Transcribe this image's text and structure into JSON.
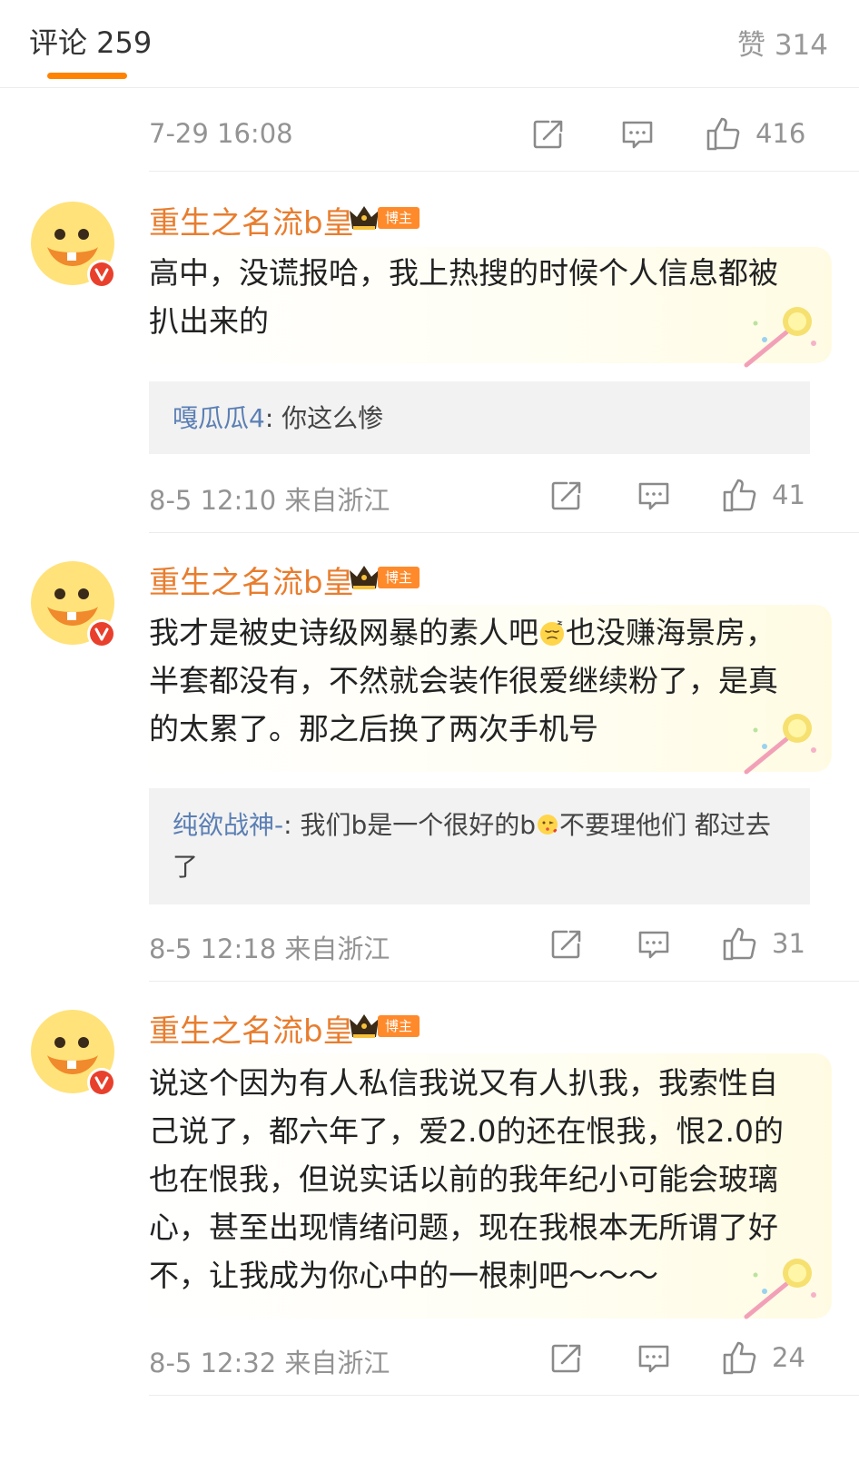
{
  "header": {
    "comments_tab": "评论 259",
    "likes_tab": "赞 314"
  },
  "top_meta": {
    "time": "7-29 16:08",
    "like_count": "416"
  },
  "comments": [
    {
      "user": "重生之名流b皇",
      "badge": "博主",
      "text": "高中，没谎报哈，我上热搜的时候个人信息都被扒出来的",
      "reply": {
        "user": "嘎瓜瓜4",
        "separator": ": ",
        "text": "你这么惨"
      },
      "time": "8-5 12:10",
      "location": "来自浙江",
      "like_count": "41"
    },
    {
      "user": "重生之名流b皇",
      "badge": "博主",
      "text_part1": "我才是被史诗级网暴的素人吧",
      "text_part2": "也没赚海景房，半套都没有，不然就会装作很爱继续粉了，是真的太累了。那之后换了两次手机号",
      "reply": {
        "user": "纯欲战神-",
        "separator": ": ",
        "text_part1": "我们b是一个很好的b",
        "text_part2": "不要理他们 都过去了"
      },
      "time": "8-5 12:18",
      "location": "来自浙江",
      "like_count": "31"
    },
    {
      "user": "重生之名流b皇",
      "badge": "博主",
      "text": "说这个因为有人私信我说又有人扒我，我索性自己说了，都六年了，爱2.0的还在恨我，恨2.0的也在恨我，但说实话以前的我年纪小可能会玻璃心，甚至出现情绪问题，现在我根本无所谓了好不，让我成为你心中的一根刺吧～～～",
      "time": "8-5 12:32",
      "location": "来自浙江",
      "like_count": "24"
    }
  ],
  "icons": {
    "share": "share-icon",
    "comment": "comment-icon",
    "like": "thumbs-up-icon",
    "verified": "verified-v-icon",
    "crown": "crown-icon"
  },
  "colors": {
    "accent": "#ff8200",
    "username": "#e87d2e",
    "reply_user": "#5b7fb4",
    "meta": "#939393",
    "verified": "#e8402c"
  }
}
